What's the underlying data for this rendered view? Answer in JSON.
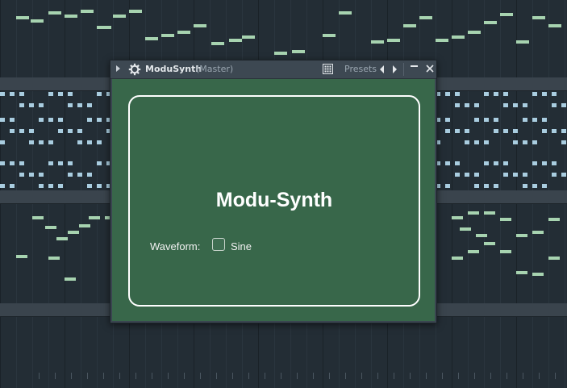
{
  "plugin_window": {
    "name": "ModuSynth",
    "channel": "(Master)",
    "presets_label": "Presets"
  },
  "synth": {
    "title": "Modu-Synth",
    "waveform_label": "Waveform:",
    "waveform_value": "Sine",
    "waveform_checked": false
  },
  "colors": {
    "plugin_background": "#38674a",
    "panel_border": "#ffffff",
    "titlebar": "#3d4852",
    "note_green": "#a7d3b0",
    "note_blue": "#a9cde0",
    "playlist_background": "#232d35"
  },
  "icons": {
    "expand": "triangle-right",
    "plugin": "gear",
    "browser": "grid",
    "previous_preset": "triangle-left",
    "next_preset": "triangle-right",
    "minimize": "minus",
    "close": "x"
  }
}
